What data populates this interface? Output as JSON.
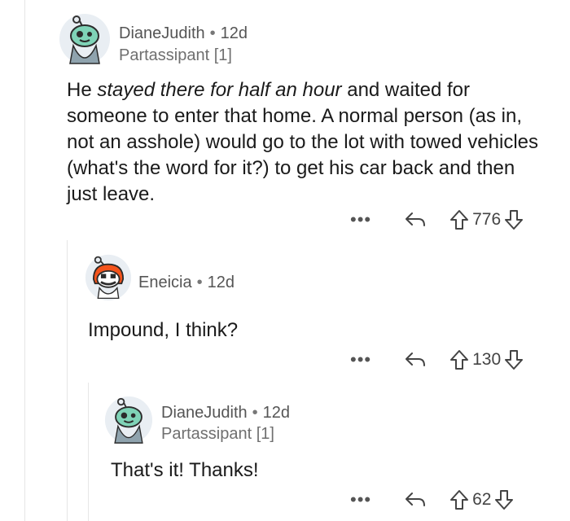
{
  "comments": [
    {
      "author": "DianeJudith",
      "age": "12d",
      "flair": "Partassipant [1]",
      "body": {
        "pre": "He ",
        "em": "stayed there for half an hour",
        "post": " and waited for someone to enter that home. A normal person (as in, not an asshole) would go to the lot with towed vehicles (what's the word for it?) to get his car back and then just leave."
      },
      "votes": "776"
    },
    {
      "author": "Eneicia",
      "age": "12d",
      "body": "Impound, I think?",
      "votes": "130"
    },
    {
      "author": "DianeJudith",
      "age": "12d",
      "flair": "Partassipant [1]",
      "body": "That's it! Thanks!",
      "votes": "62"
    }
  ],
  "icons": {
    "more": "more-options-icon",
    "reply": "reply-arrow-icon",
    "upvote": "upvote-arrow-icon",
    "downvote": "downvote-arrow-icon"
  },
  "colors": {
    "avatar_bg": "#e9eef3",
    "snoo_green": "#7fd3b7",
    "snoo_orange": "#f4541c",
    "thread_line": "#e6e6e6"
  }
}
